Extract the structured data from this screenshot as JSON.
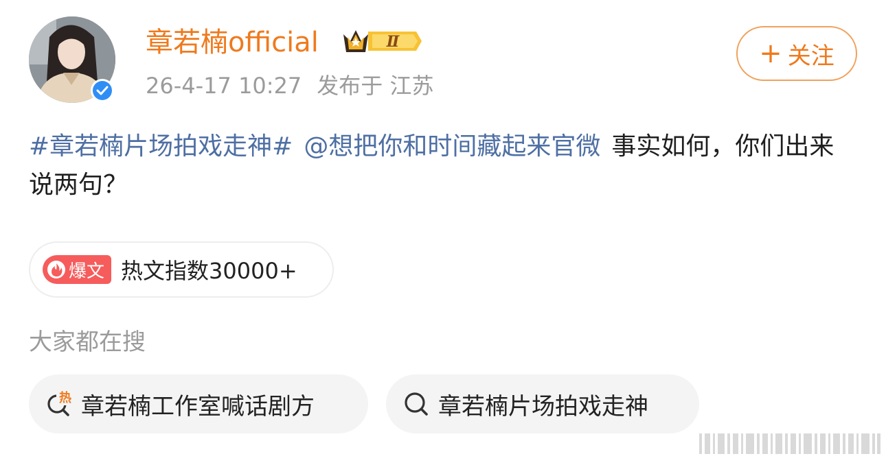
{
  "user": {
    "name": "章若楠official",
    "vip_level": "Ⅱ",
    "verified_color": "#2f8ef6"
  },
  "post": {
    "timestamp": "26-4-17 10:27",
    "location": "发布于 江苏",
    "topic": "#章若楠片场拍戏走神#",
    "mention": "@想把你和时间藏起来官微",
    "text": "事实如何，你们出来说两句？"
  },
  "follow_button": {
    "label": "关注"
  },
  "hot": {
    "badge": "爆文",
    "label": "热文指数30000+"
  },
  "search": {
    "title": "大家都在搜",
    "items": [
      {
        "label": "章若楠工作室喊话剧方",
        "icon": "hot-search-icon",
        "hot_mark": "热"
      },
      {
        "label": "章若楠片场拍戏走神",
        "icon": "search-icon"
      }
    ]
  },
  "colors": {
    "accent": "#ef7a1d",
    "link": "#4e6fa3",
    "hot_badge": "#f65c5c",
    "muted": "#9b9b9b"
  }
}
